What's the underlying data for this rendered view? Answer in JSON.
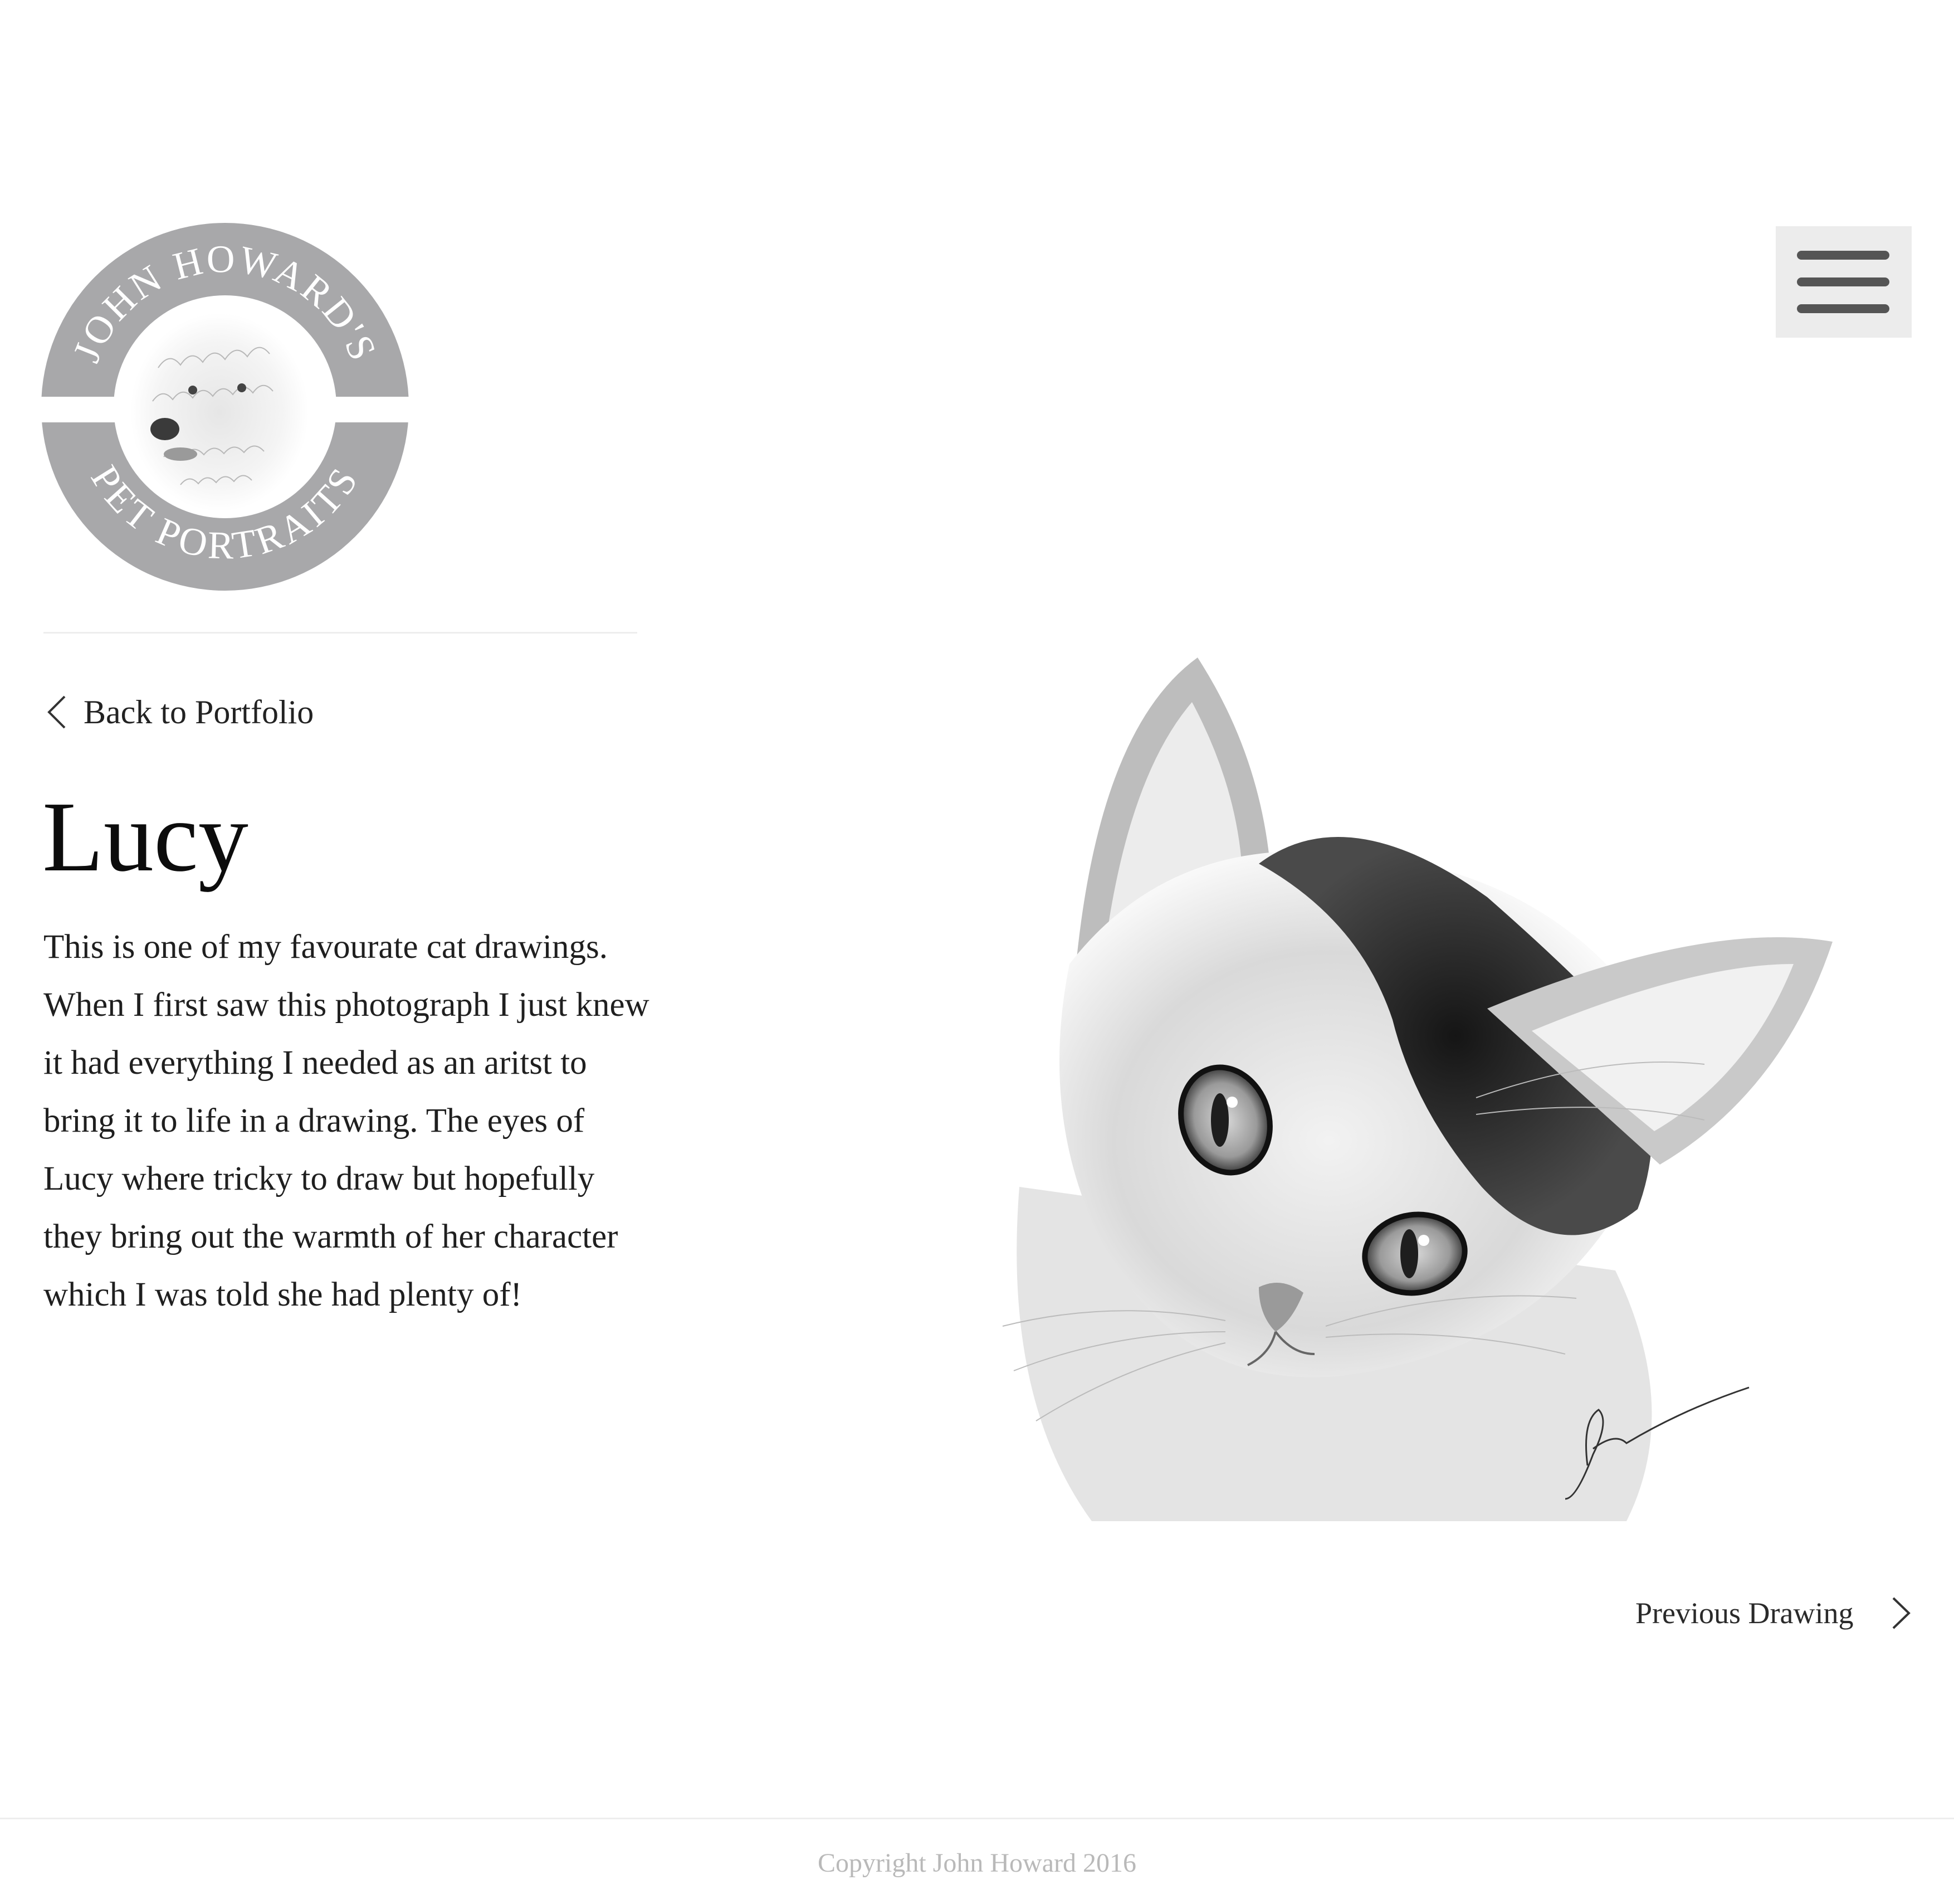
{
  "logo": {
    "top_text": "JOHN HOWARD'S",
    "bottom_text": "PET PORTRAITS",
    "ring_color": "#a8a8aa",
    "icon": "dog-portrait-icon"
  },
  "header": {
    "menu_icon": "hamburger-menu-icon"
  },
  "nav": {
    "back_label": "Back to Portfolio",
    "back_icon": "chevron-left-icon"
  },
  "artwork": {
    "title": "Lucy",
    "description": "This is one of my favourate cat drawings. When I first saw this photograph I just knew it had everything I needed as an aritst to bring it to life in a drawing. The eyes of Lucy where tricky to draw but hopefully they bring out the warmth of her character which I was told she had plenty of!",
    "image_icon": "cat-drawing-image"
  },
  "pager": {
    "previous_label": "Previous Drawing",
    "previous_icon": "chevron-right-icon"
  },
  "footer": {
    "copyright": "Copyright John Howard 2016"
  }
}
